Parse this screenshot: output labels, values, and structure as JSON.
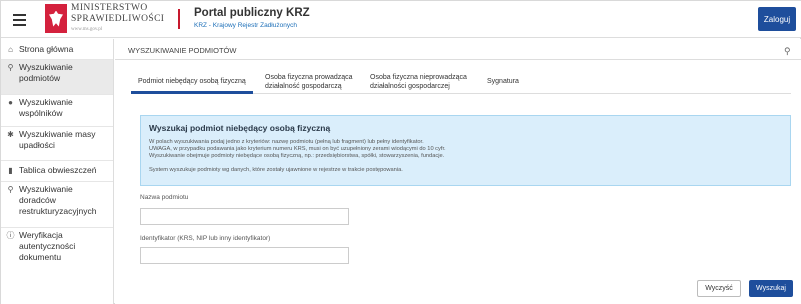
{
  "header": {
    "menu_icon": "hamburger-icon",
    "logo_icon": "polish-eagle-emblem",
    "ministry_line1": "MINISTERSTWO",
    "ministry_line2": "SPRAWIEDLIWOŚCI",
    "ministry_url": "www.ms.gov.pl",
    "portal_title": "Portal publiczny KRZ",
    "portal_subtitle": "KRZ - Krajowy Rejestr Zadłużonych",
    "login_label": "Zaloguj",
    "accent_color": "#1e4e9c",
    "brand_red": "#c7192e"
  },
  "sidebar": {
    "items": [
      {
        "label": "Strona główna",
        "icon": "home-icon"
      },
      {
        "label": "Wyszukiwanie podmiotów",
        "icon": "search-user-icon",
        "active": true
      },
      {
        "label": "Wyszukiwanie wspólników",
        "icon": "user-icon"
      },
      {
        "label": "Wyszukiwanie masy upadłości",
        "icon": "gear-icon"
      },
      {
        "label": "Tablica obwieszczeń",
        "icon": "notice-board-icon"
      },
      {
        "label": "Wyszukiwanie doradców restrukturyzacyjnych",
        "icon": "search-user-icon"
      },
      {
        "label": "Weryfikacja autentyczności dokumentu",
        "icon": "info-circle-icon"
      }
    ]
  },
  "main": {
    "title": "WYSZUKIWANIE PODMIOTÓW",
    "user_icon": "user-search-icon",
    "tabs": [
      {
        "label": "Podmiot niebędący osobą fizyczną",
        "active": true
      },
      {
        "label_line1": "Osoba fizyczna prowadząca",
        "label_line2": "działalność gospodarczą"
      },
      {
        "label_line1": "Osoba fizyczna nieprowadząca",
        "label_line2": "działalności gospodarczej"
      },
      {
        "label": "Sygnatura"
      }
    ],
    "info": {
      "title": "Wyszukaj podmiot niebędący osobą fizyczną",
      "line1": "W polach wyszukiwania podaj jedno z kryteriów: nazwę podmiotu (pełną lub fragment) lub pełny identyfikator.",
      "line2": "UWAGA, w przypadku podawania jako kryterium numeru KRS, musi on być uzupełniony zerami wiodącymi do 10 cyfr.",
      "line3": "Wyszukiwanie obejmuje podmioty niebędące osobą fizyczną, np.: przedsiębiorstwa, spółki, stowarzyszenia, fundacje.",
      "line4": "System wyszukuje podmioty wg danych, które zostały ujawnione w rejestrze w trakcie postępowania."
    },
    "fields": {
      "name_label": "Nazwa podmiotu",
      "name_value": "",
      "id_label": "Identyfikator (KRS, NIP lub inny identyfikator)",
      "id_value": ""
    },
    "buttons": {
      "clear": "Wyczyść",
      "search": "Wyszukaj"
    }
  }
}
